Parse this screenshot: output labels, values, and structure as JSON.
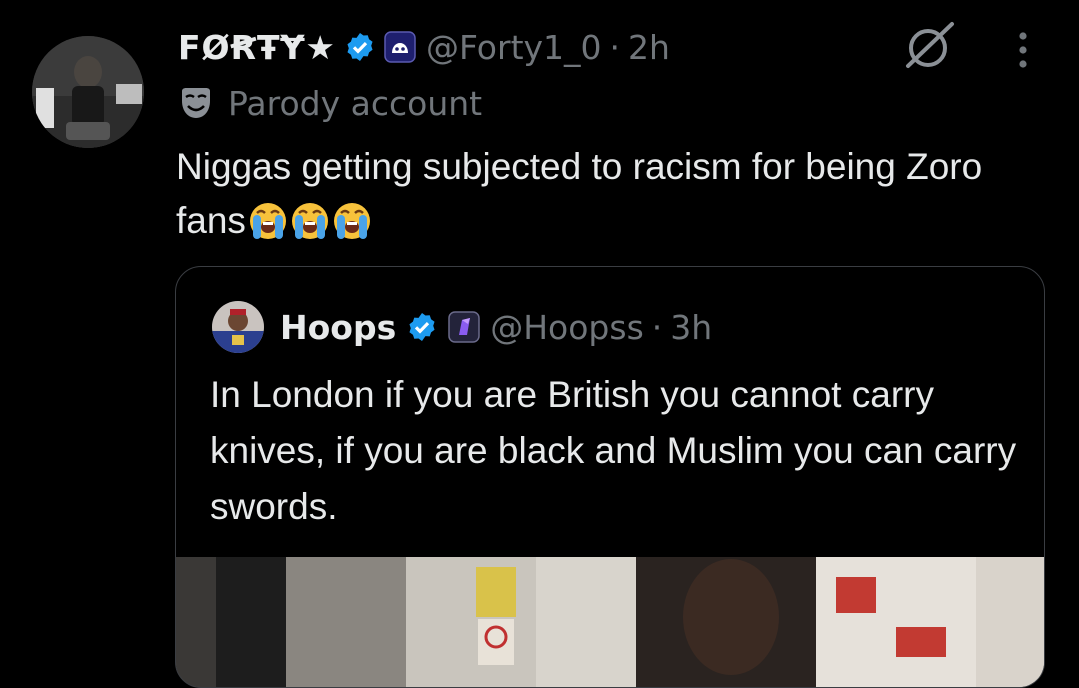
{
  "tweet": {
    "display_name": "FØꞦŦɎ★",
    "handle": "@Forty1_0",
    "separator": "·",
    "time": "2h",
    "parody_label": "Parody account",
    "text": "Niggas getting subjected to racism for being Zoro fans",
    "emoji_count": 3,
    "emoji_name": "loudly-crying-face"
  },
  "quote": {
    "display_name": "Hoops",
    "handle": "@Hoopss",
    "separator": "·",
    "time": "3h",
    "text": "In London if you are British you cannot carry knives, if you are black and Muslim you can carry swords."
  },
  "colors": {
    "background": "#000000",
    "text": "#e7e9ea",
    "secondary": "#71767b",
    "verified": "#1d9bf0",
    "border": "#3a3d42"
  }
}
